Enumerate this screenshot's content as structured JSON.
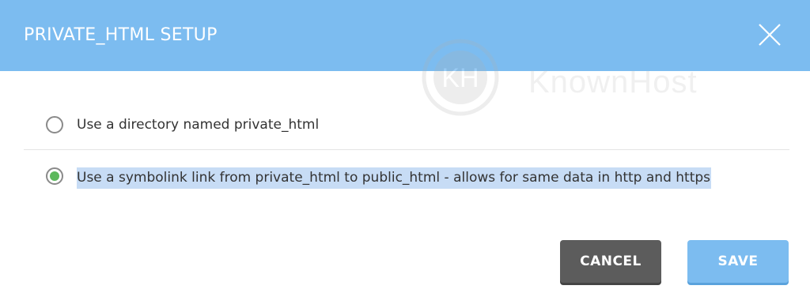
{
  "dialog": {
    "title": "PRIVATE_HTML SETUP",
    "close_icon": "close-icon",
    "header_color": "#7cbcf0"
  },
  "watermark": {
    "logo_text": "KH",
    "brand_text": "KnownHost"
  },
  "options": [
    {
      "label": "Use a directory named private_html",
      "selected": false
    },
    {
      "label": "Use a symbolink link from private_html to public_html - allows for same data in http and https",
      "selected": true
    }
  ],
  "buttons": {
    "cancel_label": "CANCEL",
    "save_label": "SAVE",
    "cancel_color": "#5c5c5c",
    "save_color": "#7cbcf0"
  },
  "accent_radio_color": "#5cb85c"
}
